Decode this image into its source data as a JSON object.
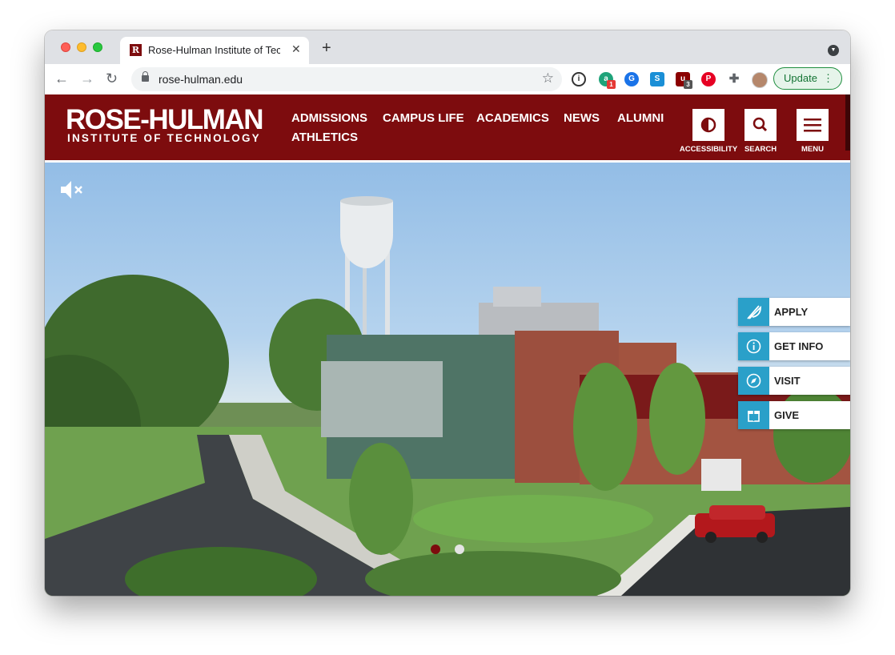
{
  "browser": {
    "tab_title": "Rose-Hulman Institute of Technology",
    "favicon_letter": "R",
    "url": "rose-hulman.edu",
    "update_label": "Update",
    "extension_badges": [
      "1",
      "3"
    ]
  },
  "site": {
    "logo_main": "ROSE-HULMAN",
    "logo_sub": "INSTITUTE OF TECHNOLOGY",
    "nav": [
      "ADMISSIONS",
      "CAMPUS LIFE",
      "ACADEMICS",
      "NEWS",
      "ALUMNI",
      "ATHLETICS"
    ],
    "utility": {
      "accessibility": "ACCESSIBILITY",
      "search": "SEARCH",
      "menu": "MENU"
    },
    "side_actions": [
      "APPLY",
      "GET INFO",
      "VISIT",
      "GIVE"
    ],
    "carousel": {
      "slides": 2,
      "active": 1
    },
    "colors": {
      "brand": "#7d0c0e",
      "accent": "#2aa0c9"
    }
  }
}
